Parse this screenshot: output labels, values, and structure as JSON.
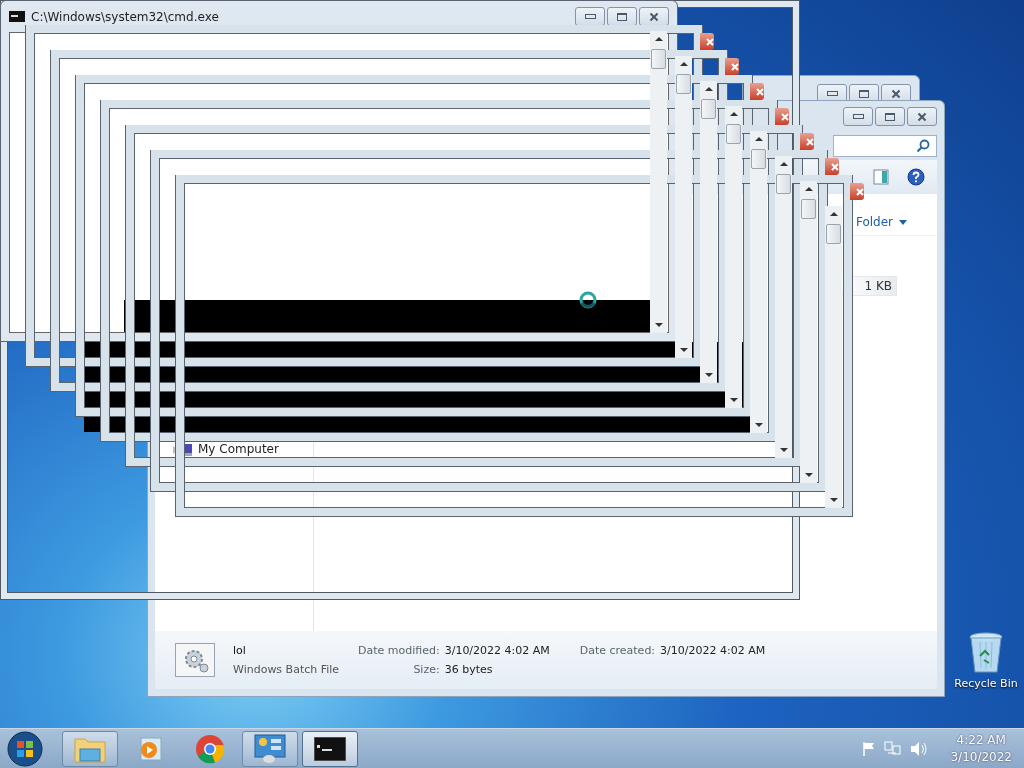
{
  "explorer": {
    "toolbar": {
      "arrange_button": "Folder"
    },
    "file_size": "1 KB",
    "nav_items": [
      {
        "label": "My Computer",
        "expanded": false
      }
    ],
    "details": {
      "name": "lol",
      "type": "Windows Batch File",
      "fields": [
        {
          "label": "Date modified:",
          "value": "3/10/2022 4:02 AM"
        },
        {
          "label": "Date created:",
          "value": "3/10/2022 4:02 AM"
        },
        {
          "label": "Size:",
          "value": "36 bytes"
        }
      ]
    }
  },
  "console_window": {
    "title": "C:\\Windows\\system32\\cmd.exe"
  },
  "desktop_icons": [
    {
      "label": "Recycle Bin"
    }
  ],
  "taskbar": {
    "items": [
      {
        "kind": "explorer",
        "selected": false,
        "open": true
      },
      {
        "kind": "media",
        "selected": false,
        "open": false
      },
      {
        "kind": "browser",
        "selected": false,
        "open": false
      },
      {
        "kind": "control",
        "selected": false,
        "open": true
      },
      {
        "kind": "console",
        "selected": true,
        "open": true
      }
    ],
    "clock": {
      "time": "4:22 AM",
      "date": "3/10/2022"
    }
  }
}
